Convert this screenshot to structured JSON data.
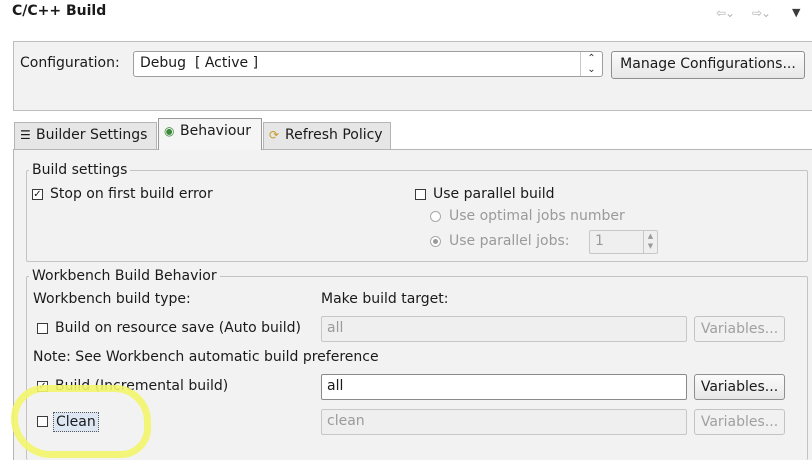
{
  "header": {
    "title": "C/C++ Build",
    "back_icon": "back-arrow-icon",
    "forward_icon": "forward-arrow-icon",
    "menu_icon": "view-menu-icon"
  },
  "configuration": {
    "label": "Configuration:",
    "selected": "Debug  [ Active ]",
    "manage_label": "Manage Configurations..."
  },
  "tabs": [
    {
      "label": "Builder Settings",
      "icon": "builder-settings-icon",
      "active": false
    },
    {
      "label": "Behaviour",
      "icon": "radio-target-icon",
      "active": true
    },
    {
      "label": "Refresh Policy",
      "icon": "refresh-policy-icon",
      "active": false
    }
  ],
  "build_settings": {
    "legend": "Build settings",
    "stop_on_error": {
      "label": "Stop on first build error",
      "checked": true
    },
    "parallel_build": {
      "label": "Use parallel build",
      "checked": false
    },
    "optimal_jobs": {
      "label": "Use optimal jobs number",
      "selected": false
    },
    "parallel_jobs": {
      "label": "Use parallel jobs:",
      "selected": true,
      "value": "1"
    }
  },
  "workbench": {
    "legend": "Workbench Build Behavior",
    "type_label": "Workbench build type:",
    "target_label": "Make build target:",
    "auto_build": {
      "label": "Build on resource save (Auto build)",
      "checked": false,
      "target": "all",
      "variables": "Variables..."
    },
    "note": "Note: See Workbench automatic build preference",
    "incremental": {
      "label": "Build (Incremental build)",
      "checked": true,
      "target": "all",
      "variables": "Variables..."
    },
    "clean": {
      "label": "Clean",
      "checked": false,
      "target": "clean",
      "variables": "Variables..."
    }
  },
  "colors": {
    "panel_bg": "#f2f2f2",
    "highlight": "#f2f56a"
  }
}
